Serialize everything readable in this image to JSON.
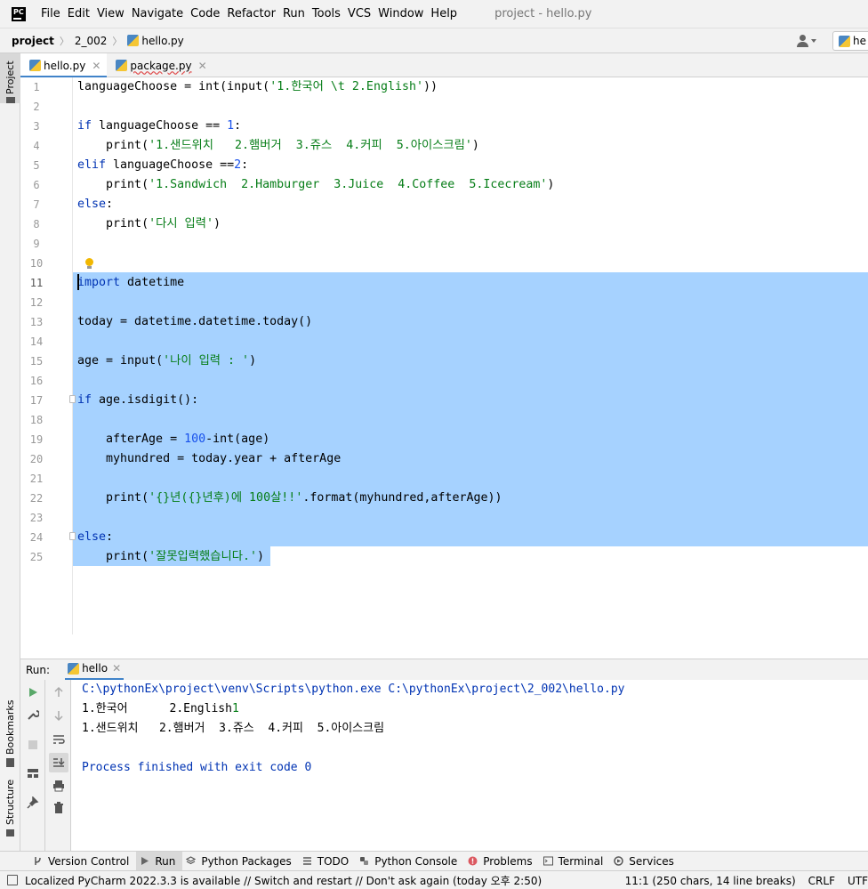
{
  "menubar": {
    "logo": "PC",
    "items": [
      "File",
      "Edit",
      "View",
      "Navigate",
      "Code",
      "Refactor",
      "Run",
      "Tools",
      "VCS",
      "Window",
      "Help"
    ],
    "title": "project - hello.py"
  },
  "navbar": {
    "crumbs": [
      "project",
      "2_002",
      "hello.py"
    ],
    "run_config": "he"
  },
  "left_strip": {
    "project": "Project",
    "bookmarks": "Bookmarks",
    "structure": "Structure"
  },
  "editor_tabs": [
    {
      "label": "hello.py",
      "active": true
    },
    {
      "label": "package.py",
      "active": false
    }
  ],
  "editor": {
    "current_line": 11,
    "lines": [
      {
        "n": "1",
        "tokens": [
          [
            "",
            "languageChoose = "
          ],
          [
            "fn",
            "int"
          ],
          [
            "",
            "("
          ],
          [
            "fn",
            "input"
          ],
          [
            "",
            "("
          ],
          [
            "str",
            "'1.한국어 \\t 2.English'"
          ],
          [
            "",
            "))"
          ]
        ]
      },
      {
        "n": "2",
        "tokens": []
      },
      {
        "n": "3",
        "tokens": [
          [
            "kw",
            "if"
          ],
          [
            "",
            " languageChoose == "
          ],
          [
            "num",
            "1"
          ],
          [
            "",
            ":"
          ]
        ]
      },
      {
        "n": "4",
        "tokens": [
          [
            "",
            "    "
          ],
          [
            "fn",
            "print"
          ],
          [
            "",
            "("
          ],
          [
            "str",
            "'1.샌드위치   2.햄버거  3.쥬스  4.커피  5.아이스크림'"
          ],
          [
            "",
            ")"
          ]
        ]
      },
      {
        "n": "5",
        "tokens": [
          [
            "kw",
            "elif"
          ],
          [
            "",
            " languageChoose =="
          ],
          [
            "num",
            "2"
          ],
          [
            "",
            ":"
          ]
        ]
      },
      {
        "n": "6",
        "tokens": [
          [
            "",
            "    "
          ],
          [
            "fn",
            "print"
          ],
          [
            "",
            "("
          ],
          [
            "str",
            "'1.Sandwich  2.Hamburger  3.Juice  4.Coffee  5.Icecream'"
          ],
          [
            "",
            ")"
          ]
        ]
      },
      {
        "n": "7",
        "tokens": [
          [
            "kw",
            "else"
          ],
          [
            "",
            ":"
          ]
        ]
      },
      {
        "n": "8",
        "tokens": [
          [
            "",
            "    "
          ],
          [
            "fn",
            "print"
          ],
          [
            "",
            "("
          ],
          [
            "str",
            "'다시 입력'"
          ],
          [
            "",
            ")"
          ]
        ]
      },
      {
        "n": "9",
        "tokens": []
      },
      {
        "n": "10",
        "tokens": []
      },
      {
        "n": "11",
        "tokens": [
          [
            "kw",
            "import"
          ],
          [
            "",
            " datetime"
          ]
        ]
      },
      {
        "n": "12",
        "tokens": []
      },
      {
        "n": "13",
        "tokens": [
          [
            "",
            "today = datetime.datetime.today()"
          ]
        ]
      },
      {
        "n": "14",
        "tokens": []
      },
      {
        "n": "15",
        "tokens": [
          [
            "",
            "age = "
          ],
          [
            "fn",
            "input"
          ],
          [
            "",
            "("
          ],
          [
            "str",
            "'나이 입력 : '"
          ],
          [
            "",
            ")"
          ]
        ]
      },
      {
        "n": "16",
        "tokens": []
      },
      {
        "n": "17",
        "tokens": [
          [
            "kw",
            "if"
          ],
          [
            "",
            " age.isdigit():"
          ]
        ]
      },
      {
        "n": "18",
        "tokens": []
      },
      {
        "n": "19",
        "tokens": [
          [
            "",
            "    afterAge = "
          ],
          [
            "num",
            "100"
          ],
          [
            "",
            "-"
          ],
          [
            "fn",
            "int"
          ],
          [
            "",
            "(age)"
          ]
        ]
      },
      {
        "n": "20",
        "tokens": [
          [
            "",
            "    myhundred = today.year + afterAge"
          ]
        ]
      },
      {
        "n": "21",
        "tokens": []
      },
      {
        "n": "22",
        "tokens": [
          [
            "",
            "    "
          ],
          [
            "fn",
            "print"
          ],
          [
            "",
            "("
          ],
          [
            "str",
            "'{}년({}년후)에 100살!!'"
          ],
          [
            "",
            ".format(myhundred,afterAge))"
          ]
        ]
      },
      {
        "n": "23",
        "tokens": []
      },
      {
        "n": "24",
        "tokens": [
          [
            "kw",
            "else"
          ],
          [
            "",
            ":"
          ]
        ]
      },
      {
        "n": "25",
        "tokens": [
          [
            "",
            "    "
          ],
          [
            "fn",
            "print"
          ],
          [
            "",
            "("
          ],
          [
            "str",
            "'잘못입력했습니다.'"
          ],
          [
            "",
            ")"
          ]
        ]
      }
    ]
  },
  "run_panel": {
    "label": "Run:",
    "tab": "hello",
    "console": [
      "C:\\pythonEx\\project\\venv\\Scripts\\python.exe C:\\pythonEx\\project\\2_002\\hello.py",
      "1.한국어      2.English",
      "1.샌드위치   2.햄버거  3.쥬스  4.커피  5.아이스크림",
      "",
      "Process finished with exit code 0"
    ],
    "user_input": "1"
  },
  "tool_tabs": [
    "Version Control",
    "Run",
    "Python Packages",
    "TODO",
    "Python Console",
    "Problems",
    "Terminal",
    "Services"
  ],
  "statusbar": {
    "message": "Localized PyCharm 2022.3.3 is available // Switch and restart // Don't ask again (today 오후 2:50)",
    "position": "11:1 (250 chars, 14 line breaks)",
    "line_ending": "CRLF",
    "encoding": "UTF"
  },
  "colors": {
    "keyword": "#0033b3",
    "string": "#067d17",
    "number": "#1750eb",
    "selection": "#a6d2ff",
    "accent": "#4083c9"
  }
}
